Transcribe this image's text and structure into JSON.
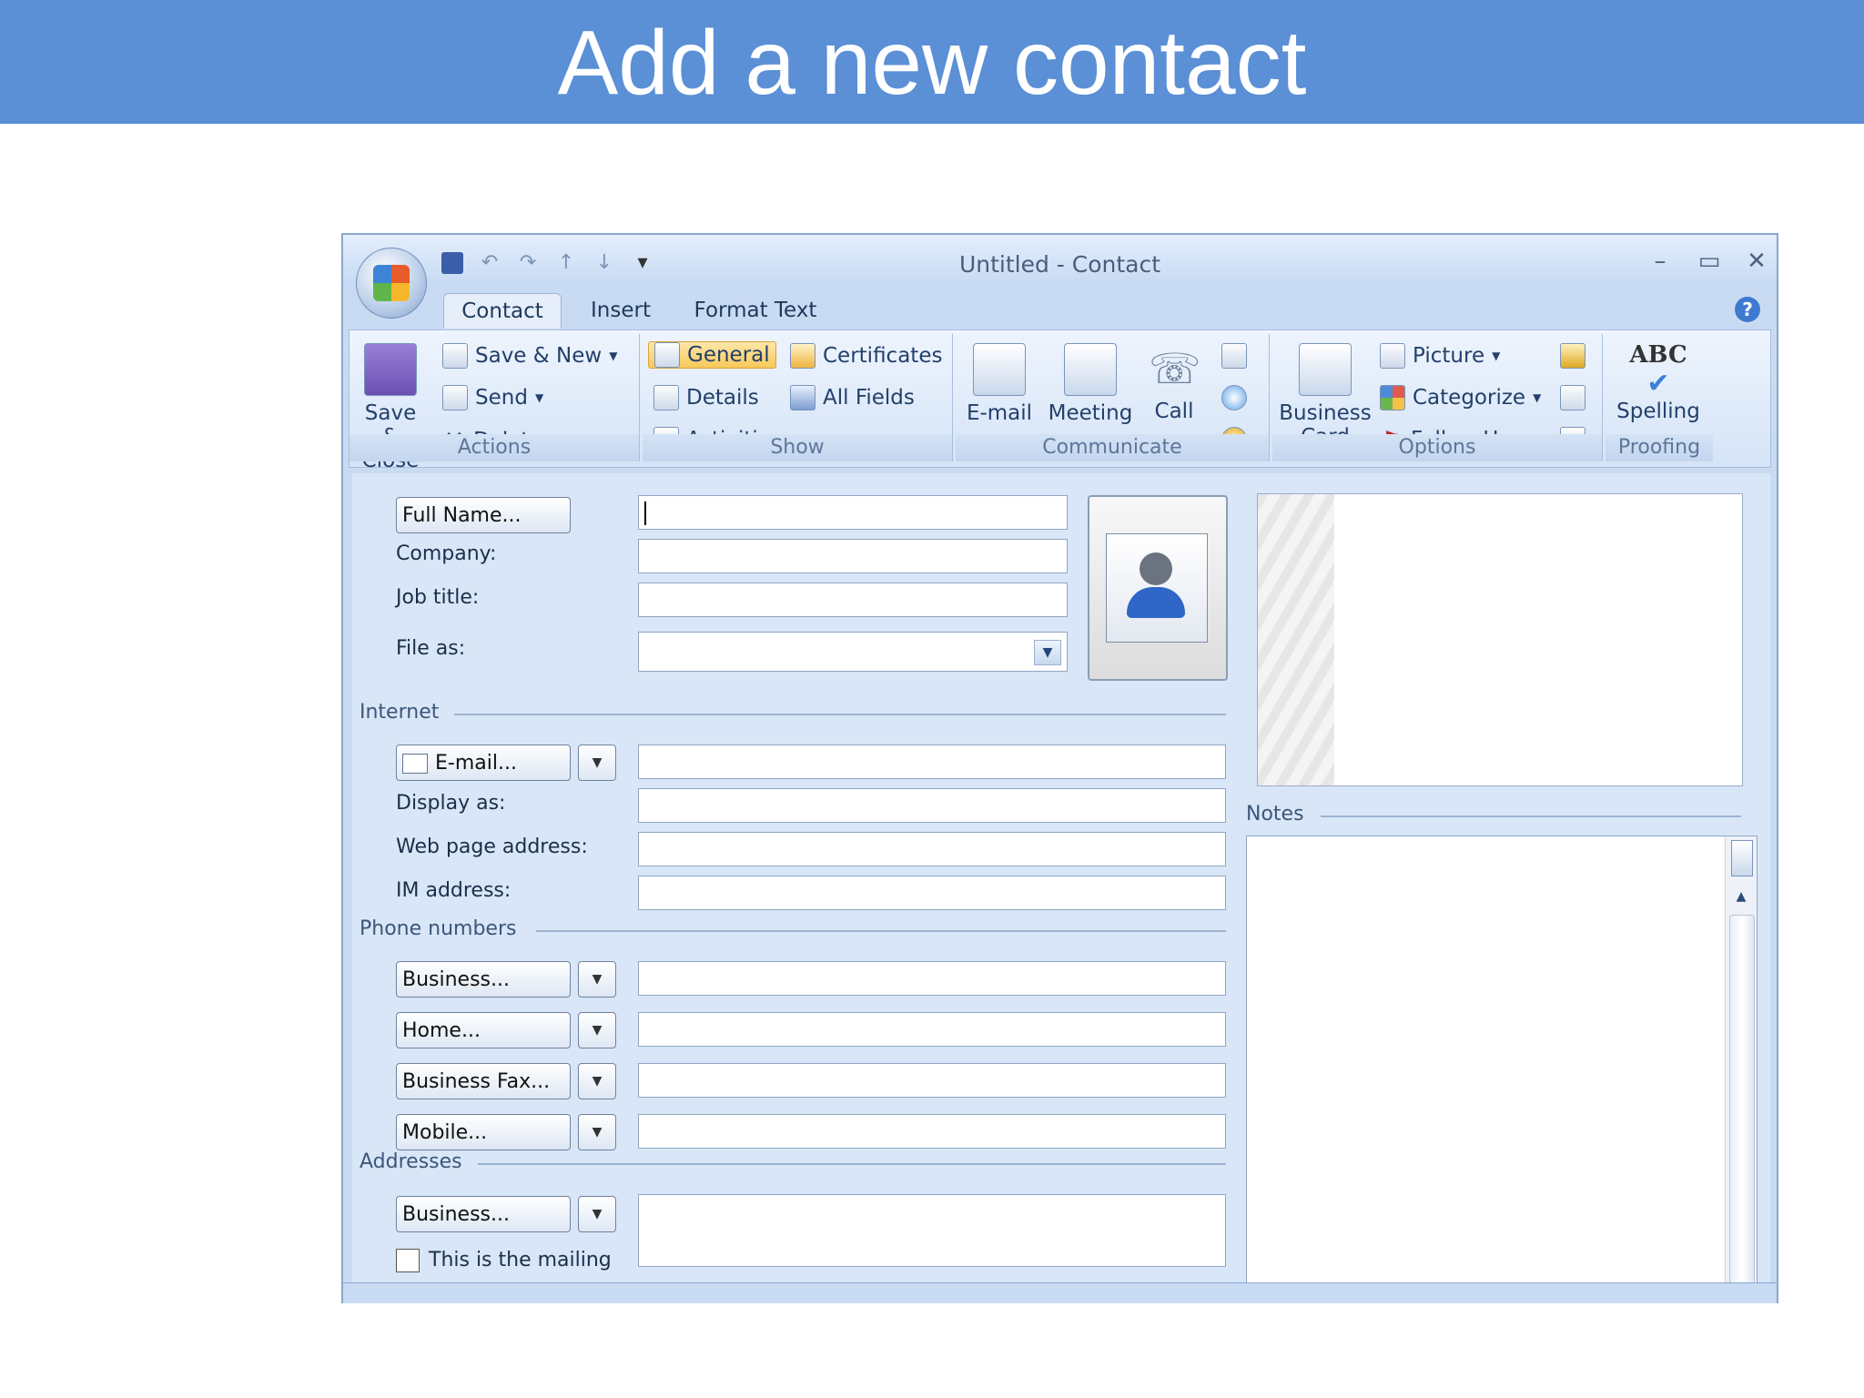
{
  "slide": {
    "title": "Add a new contact"
  },
  "window": {
    "title": "Untitled  -  Contact",
    "controls": {
      "minimize": "–",
      "maximize": "▭",
      "close": "✕"
    }
  },
  "quick_access": {
    "customize": "▾"
  },
  "tabs": [
    "Contact",
    "Insert",
    "Format Text"
  ],
  "ribbon": {
    "actions": {
      "label": "Actions",
      "save_close": [
        "Save &",
        "Close"
      ],
      "save_new": "Save & New",
      "send": "Send",
      "delete": "Delete"
    },
    "show": {
      "label": "Show",
      "general": "General",
      "details": "Details",
      "activities": "Activities",
      "certificates": "Certificates",
      "all_fields": "All Fields"
    },
    "communicate": {
      "label": "Communicate",
      "email": "E-mail",
      "meeting": "Meeting",
      "call": "Call"
    },
    "options": {
      "label": "Options",
      "business_card": [
        "Business",
        "Card"
      ],
      "picture": "Picture",
      "categorize": "Categorize",
      "follow_up": "Follow Up"
    },
    "proofing": {
      "label": "Proofing",
      "spelling": "Spelling",
      "abc": "ABC"
    }
  },
  "form": {
    "full_name": "Full Name...",
    "company": "Company:",
    "job_title": "Job title:",
    "file_as": "File as:",
    "internet": "Internet",
    "email": "E-mail...",
    "display_as": "Display as:",
    "web_page": "Web page address:",
    "im_address": "IM address:",
    "phone_numbers": "Phone numbers",
    "phones": [
      "Business...",
      "Home...",
      "Business Fax...",
      "Mobile..."
    ],
    "addresses": "Addresses",
    "address_type": "Business...",
    "mailing": "This is the mailing",
    "notes": "Notes"
  }
}
